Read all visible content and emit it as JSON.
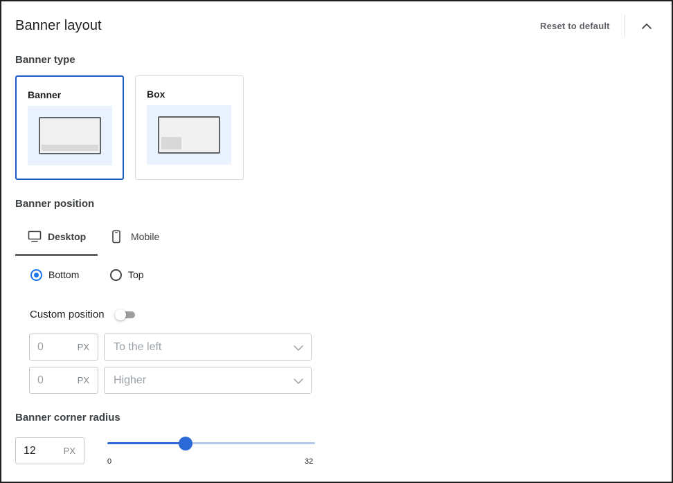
{
  "header": {
    "title": "Banner layout",
    "reset_label": "Reset to default",
    "collapse_icon": "chevron-up-icon"
  },
  "banner_type": {
    "label": "Banner type",
    "options": [
      {
        "label": "Banner",
        "selected": true
      },
      {
        "label": "Box",
        "selected": false
      }
    ]
  },
  "banner_position": {
    "label": "Banner position",
    "tabs": [
      {
        "label": "Desktop",
        "icon": "monitor-icon",
        "active": true
      },
      {
        "label": "Mobile",
        "icon": "smartphone-icon",
        "active": false
      }
    ],
    "radios": [
      {
        "label": "Bottom",
        "checked": true
      },
      {
        "label": "Top",
        "checked": false
      }
    ],
    "custom_position": {
      "label": "Custom position",
      "enabled": false
    },
    "horizontal": {
      "value": "0",
      "unit": "PX",
      "direction": "To the left"
    },
    "vertical": {
      "value": "0",
      "unit": "PX",
      "direction": "Higher"
    }
  },
  "corner_radius": {
    "label": "Banner corner radius",
    "value": "12",
    "unit": "PX",
    "min_label": "0",
    "max_label": "32",
    "min": 0,
    "max": 32
  },
  "colors": {
    "accent": "#1a73e8",
    "selected_border": "#1a5bc7",
    "preview_bg": "#eaf2fe"
  }
}
